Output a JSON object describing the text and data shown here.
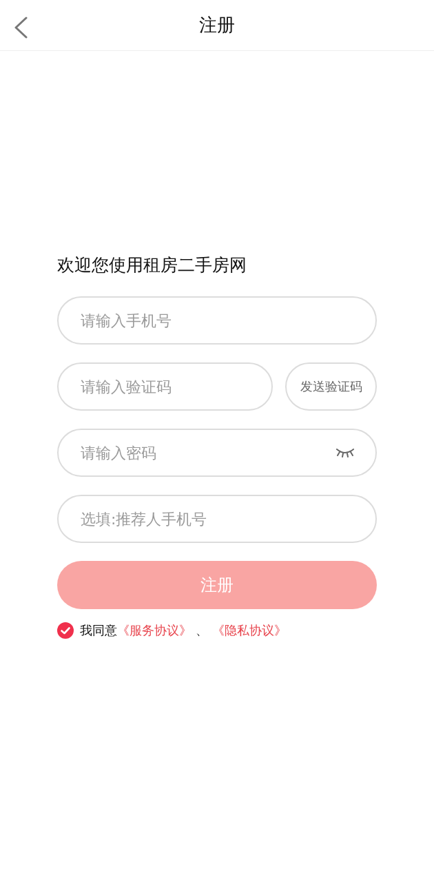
{
  "header": {
    "title": "注册"
  },
  "welcome": "欢迎您使用租房二手房网",
  "fields": [
    {
      "kind": "text",
      "placeholder": "请输入手机号"
    },
    {
      "kind": "code",
      "placeholder": "请输入验证码",
      "button": "发送验证码"
    },
    {
      "kind": "password",
      "placeholder": "请输入密码",
      "password_visible": false
    },
    {
      "kind": "text",
      "placeholder": "选填:推荐人手机号"
    }
  ],
  "submit": {
    "label": "注册",
    "disabled": true
  },
  "agreement": {
    "checked": true,
    "label": "我同意",
    "links": [
      "《服务协议》",
      "《隐私协议》"
    ],
    "separator": "、"
  }
}
